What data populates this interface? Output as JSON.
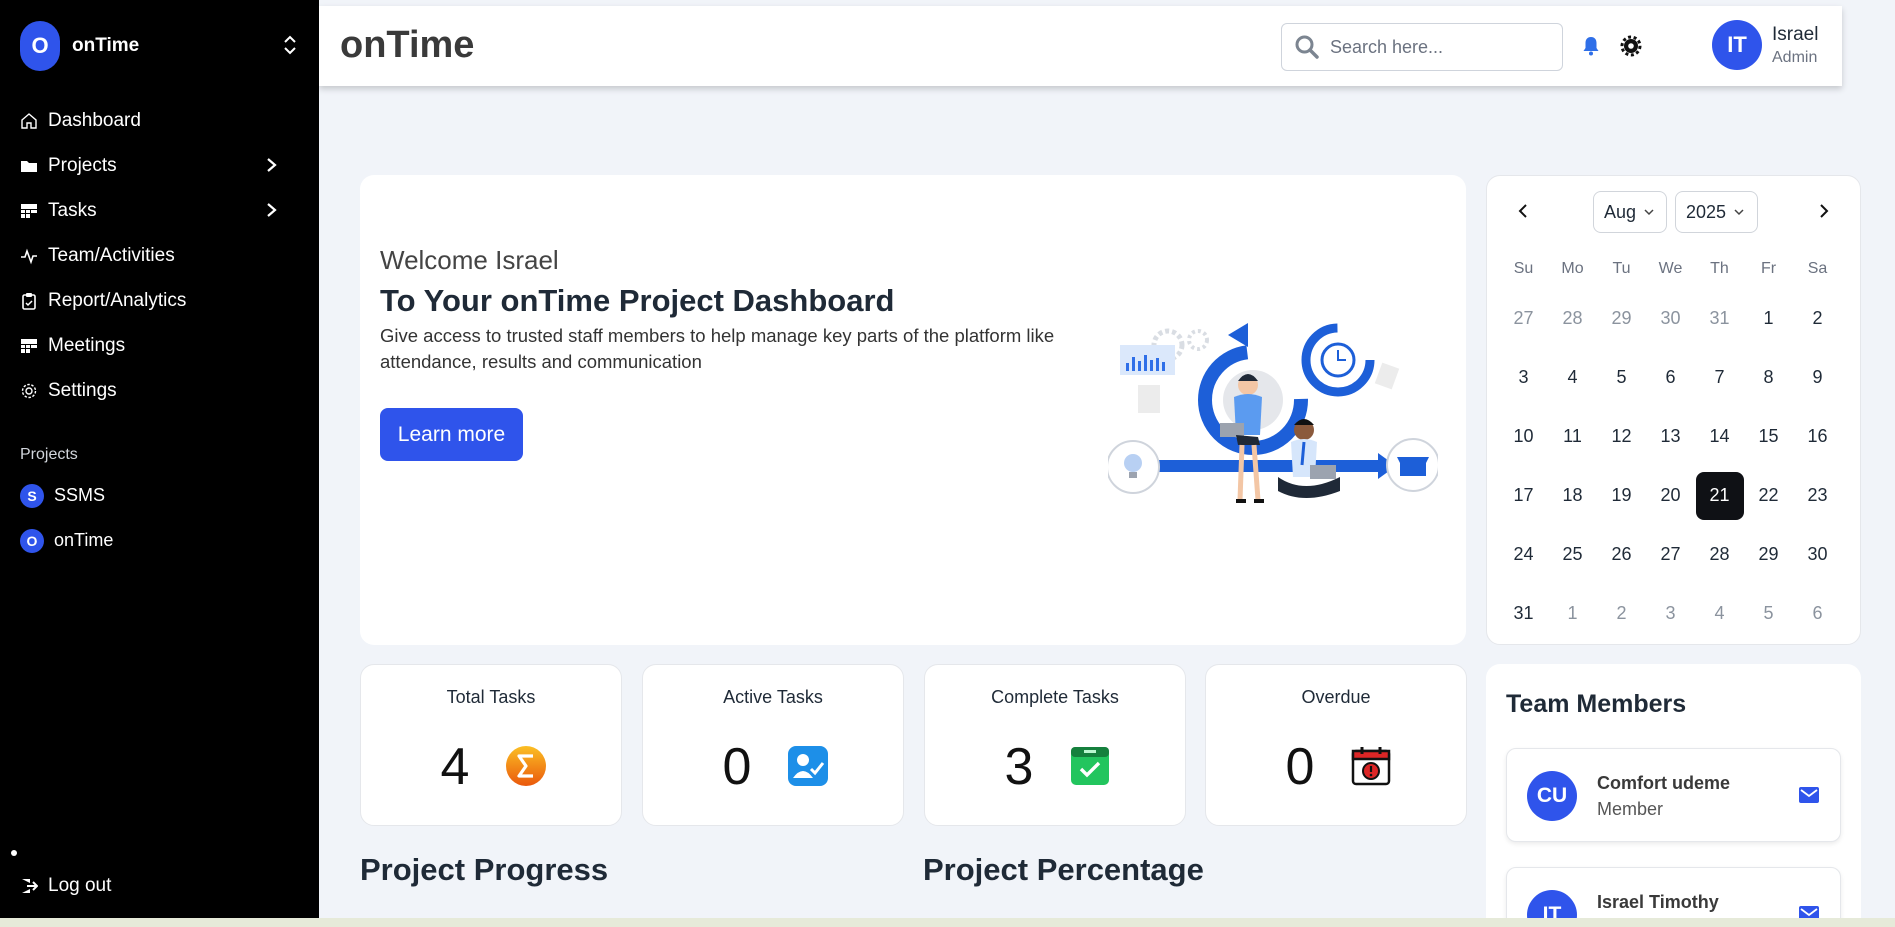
{
  "app": {
    "name": "onTime",
    "logo_letter": "O"
  },
  "sidebar": {
    "items": [
      {
        "label": "Dashboard",
        "icon": "home-icon",
        "has_chevron": false
      },
      {
        "label": "Projects",
        "icon": "folder-icon",
        "has_chevron": true
      },
      {
        "label": "Tasks",
        "icon": "tasks-icon",
        "has_chevron": true
      },
      {
        "label": "Team/Activities",
        "icon": "activity-icon",
        "has_chevron": false
      },
      {
        "label": "Report/Analytics",
        "icon": "clipboard-icon",
        "has_chevron": false
      },
      {
        "label": "Meetings",
        "icon": "meetings-icon",
        "has_chevron": false
      },
      {
        "label": "Settings",
        "icon": "gear-icon",
        "has_chevron": false
      }
    ],
    "section_label": "Projects",
    "projects": [
      {
        "letter": "S",
        "name": "SSMS"
      },
      {
        "letter": "O",
        "name": "onTime"
      }
    ],
    "logout_label": "Log out"
  },
  "header": {
    "title": "onTime",
    "search_placeholder": "Search here...",
    "user": {
      "initials": "IT",
      "name": "Israel",
      "role": "Admin"
    }
  },
  "welcome": {
    "greeting": "Welcome Israel",
    "title": "To Your onTime Project Dashboard",
    "description": "Give access to trusted staff members to help manage key parts of the platform like attendance, results and communication",
    "button_label": "Learn more"
  },
  "calendar": {
    "month": "Aug",
    "year": "2025",
    "weekdays": [
      "Su",
      "Mo",
      "Tu",
      "We",
      "Th",
      "Fr",
      "Sa"
    ],
    "weeks": [
      [
        "27",
        "28",
        "29",
        "30",
        "31",
        "1",
        "2"
      ],
      [
        "3",
        "4",
        "5",
        "6",
        "7",
        "8",
        "9"
      ],
      [
        "10",
        "11",
        "12",
        "13",
        "14",
        "15",
        "16"
      ],
      [
        "17",
        "18",
        "19",
        "20",
        "21",
        "22",
        "23"
      ],
      [
        "24",
        "25",
        "26",
        "27",
        "28",
        "29",
        "30"
      ],
      [
        "31",
        "1",
        "2",
        "3",
        "4",
        "5",
        "6"
      ]
    ],
    "selected": "21"
  },
  "stats": [
    {
      "label": "Total Tasks",
      "value": "4",
      "icon": "sigma-icon",
      "color": "#f97316"
    },
    {
      "label": "Active Tasks",
      "value": "0",
      "icon": "user-check-icon",
      "color": "#1d8fe8"
    },
    {
      "label": "Complete Tasks",
      "value": "3",
      "icon": "check-box-icon",
      "color": "#22c55e"
    },
    {
      "label": "Overdue",
      "value": "0",
      "icon": "calendar-alert-icon",
      "color": "#dc2626"
    }
  ],
  "sections": {
    "progress": "Project Progress",
    "percentage": "Project Percentage"
  },
  "team": {
    "title": "Team Members",
    "members": [
      {
        "initials": "CU",
        "name": "Comfort udeme",
        "role": "Member"
      },
      {
        "initials": "IT",
        "name": "Israel Timothy",
        "role": ""
      }
    ]
  },
  "colors": {
    "accent": "#2f54eb",
    "sidebar_bg": "#000000",
    "page_bg": "#f1f4f9"
  }
}
